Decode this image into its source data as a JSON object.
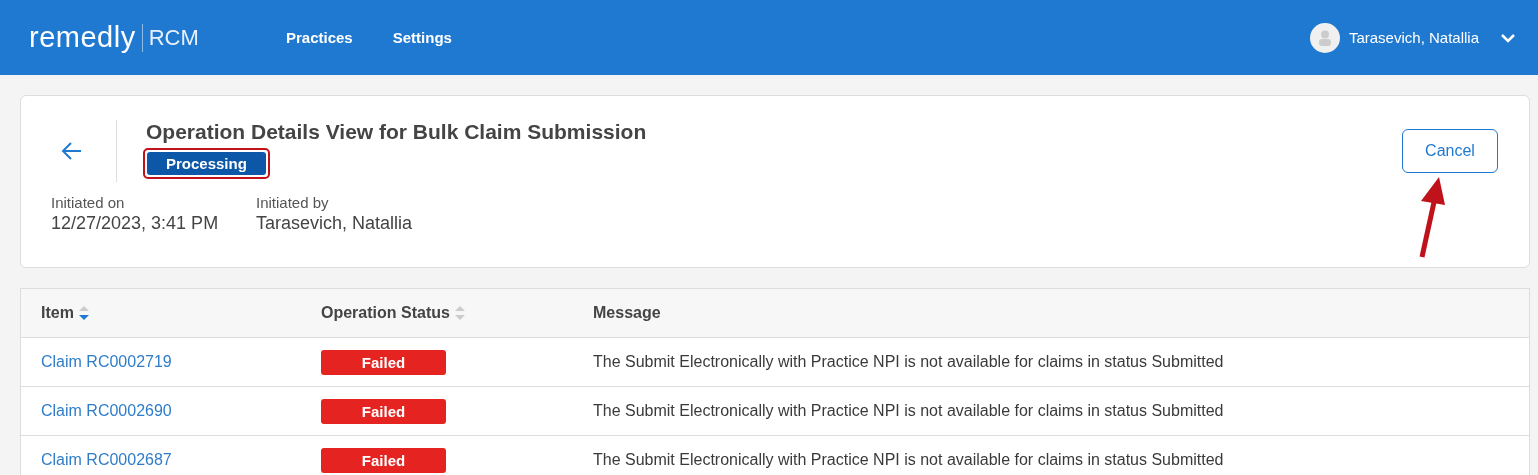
{
  "header": {
    "logo": {
      "brand": "remedly",
      "product": "RCM"
    },
    "nav": [
      {
        "label": "Practices"
      },
      {
        "label": "Settings"
      }
    ],
    "user": {
      "name": "Tarasevich, Natallia"
    }
  },
  "operation": {
    "title": "Operation Details View for Bulk Claim Submission",
    "status": {
      "label": "Processing",
      "highlighted": true
    },
    "meta": [
      {
        "label": "Initiated on",
        "value": "12/27/2023, 3:41 PM"
      },
      {
        "label": "Initiated by",
        "value": "Tarasevich, Natallia"
      }
    ],
    "cancel": {
      "label": "Cancel",
      "arrow_pointing": true
    }
  },
  "table": {
    "columns": [
      {
        "label": "Item",
        "sortable": true,
        "sorted": true
      },
      {
        "label": "Operation Status",
        "sortable": true,
        "sorted": false
      },
      {
        "label": "Message",
        "sortable": false
      }
    ],
    "rows": [
      {
        "item": "Claim RC0002719",
        "status": "Failed",
        "message": "The Submit Electronically with Practice NPI is not available for claims in status Submitted"
      },
      {
        "item": "Claim RC0002690",
        "status": "Failed",
        "message": "The Submit Electronically with Practice NPI is not available for claims in status Submitted"
      },
      {
        "item": "Claim RC0002687",
        "status": "Failed",
        "message": "The Submit Electronically with Practice NPI is not available for claims in status Submitted"
      }
    ]
  }
}
